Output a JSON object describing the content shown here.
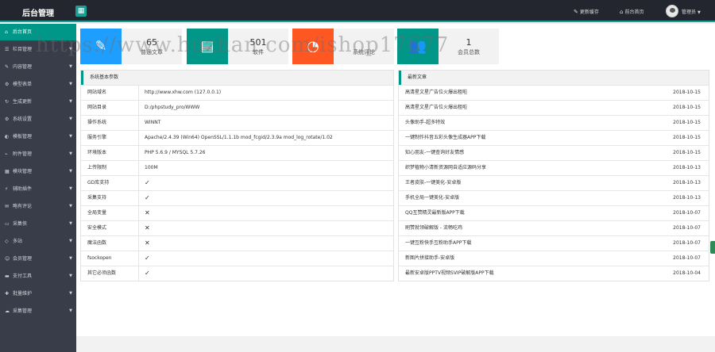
{
  "header": {
    "brand": "后台管理",
    "menu_toggle_icon": "grid-icon",
    "update_cache": "更新缓存",
    "site_home": "前台首页",
    "admin_label": "管理员"
  },
  "sidebar": {
    "items": [
      {
        "label": "后台首页",
        "icon": "home-icon",
        "active": true,
        "has_arrow": false
      },
      {
        "label": "栏目管理",
        "icon": "list-icon",
        "active": false,
        "has_arrow": true
      },
      {
        "label": "内容管理",
        "icon": "edit-icon",
        "active": false,
        "has_arrow": true
      },
      {
        "label": "模型表单",
        "icon": "gear-icon",
        "active": false,
        "has_arrow": true
      },
      {
        "label": "生成更新",
        "icon": "refresh-icon",
        "active": false,
        "has_arrow": true
      },
      {
        "label": "系统设置",
        "icon": "gear-icon",
        "active": false,
        "has_arrow": true
      },
      {
        "label": "模板管理",
        "icon": "palette-icon",
        "active": false,
        "has_arrow": true
      },
      {
        "label": "附件管理",
        "icon": "paperclip-icon",
        "active": false,
        "has_arrow": true
      },
      {
        "label": "模块管理",
        "icon": "module-icon",
        "active": false,
        "has_arrow": true
      },
      {
        "label": "辅助插件",
        "icon": "plug-icon",
        "active": false,
        "has_arrow": true
      },
      {
        "label": "略有评论",
        "icon": "comment-icon",
        "active": false,
        "has_arrow": true
      },
      {
        "label": "采集侠",
        "icon": "folder-icon",
        "active": false,
        "has_arrow": true
      },
      {
        "label": "多站",
        "icon": "sites-icon",
        "active": false,
        "has_arrow": true
      },
      {
        "label": "会员管理",
        "icon": "user-icon",
        "active": false,
        "has_arrow": true
      },
      {
        "label": "支付工具",
        "icon": "card-icon",
        "active": false,
        "has_arrow": true
      },
      {
        "label": "批量维护",
        "icon": "tools-icon",
        "active": false,
        "has_arrow": true
      },
      {
        "label": "采集管理",
        "icon": "cloud-icon",
        "active": false,
        "has_arrow": true
      }
    ]
  },
  "stats": [
    {
      "num": "65",
      "label": "普通文章",
      "color": "#1e9fff",
      "icon": "pen-icon"
    },
    {
      "num": "",
      "label": "",
      "color": "#009688",
      "icon": "doc-icon"
    },
    {
      "num": "501",
      "label": "软件",
      "color": "#009688",
      "icon": "app-icon"
    },
    {
      "num": "",
      "label": "系统评论",
      "color": "#ff5722",
      "icon": "comment-icon"
    },
    {
      "num": "1",
      "label": "会员总数",
      "color": "#009688",
      "icon": "users-icon"
    }
  ],
  "sysinfo": {
    "title": "系统基本参数",
    "rows": [
      {
        "k": "网站域名",
        "v": "http://www.xhw.com (127.0.0.1)",
        "type": "text"
      },
      {
        "k": "网站目录",
        "v": "D:/phpstudy_pro/WWW",
        "type": "text"
      },
      {
        "k": "操作系统",
        "v": "WINNT",
        "type": "text"
      },
      {
        "k": "服务引擎",
        "v": "Apache/2.4.39 (Win64) OpenSSL/1.1.1b mod_fcgid/2.3.9a mod_log_rotate/1.02",
        "type": "text"
      },
      {
        "k": "环境版本",
        "v": "PHP 5.6.9 / MYSQL 5.7.26",
        "type": "text"
      },
      {
        "k": "上传限制",
        "v": "100M",
        "type": "text"
      },
      {
        "k": "GD库支持",
        "v": "✓",
        "type": "mark"
      },
      {
        "k": "采集支持",
        "v": "✓",
        "type": "mark"
      },
      {
        "k": "全局变量",
        "v": "✕",
        "type": "mark"
      },
      {
        "k": "安全模式",
        "v": "✕",
        "type": "mark"
      },
      {
        "k": "魔法函数",
        "v": "✕",
        "type": "mark"
      },
      {
        "k": "fsockopen",
        "v": "✓",
        "type": "mark"
      },
      {
        "k": "其它必须函数",
        "v": "✓",
        "type": "mark"
      }
    ]
  },
  "articles": {
    "title": "最新文章",
    "rows": [
      {
        "t": "高清星文星广告位火爆出租啦",
        "d": "2018-10-15"
      },
      {
        "t": "高清星文星广告位火爆出租啦",
        "d": "2018-10-15"
      },
      {
        "t": "头像助手-超多特效",
        "d": "2018-10-15"
      },
      {
        "t": "一键制作抖音五彩头像生成器APP下载",
        "d": "2018-10-15"
      },
      {
        "t": "知心朋友-一键查询好友情感",
        "d": "2018-10-15"
      },
      {
        "t": "织梦植物小清新资源网自适应源码分享",
        "d": "2018-10-13"
      },
      {
        "t": "王者皮肤-一键美化-安卓版",
        "d": "2018-10-13"
      },
      {
        "t": "手机全局一键美化-安卓版",
        "d": "2018-10-13"
      },
      {
        "t": "QQ互赞精灵最新版APP下载",
        "d": "2018-10-07"
      },
      {
        "t": "刷赞就领破解版 - 流畅吃鸡",
        "d": "2018-10-07"
      },
      {
        "t": "一键互粉快手互粉助手APP下载",
        "d": "2018-10-07"
      },
      {
        "t": "新图片拼接助手-安卓版",
        "d": "2018-10-07"
      },
      {
        "t": "最新安卓版PPTV视频SVIP破解版APP下载",
        "d": "2018-10-04"
      }
    ]
  },
  "watermark": "https://www.huzhan.com/ishop17677",
  "colors": {
    "accent": "#009688",
    "topbar": "#23262e",
    "sidebar": "#393d49",
    "orange": "#ff5722",
    "blue": "#1e9fff"
  }
}
